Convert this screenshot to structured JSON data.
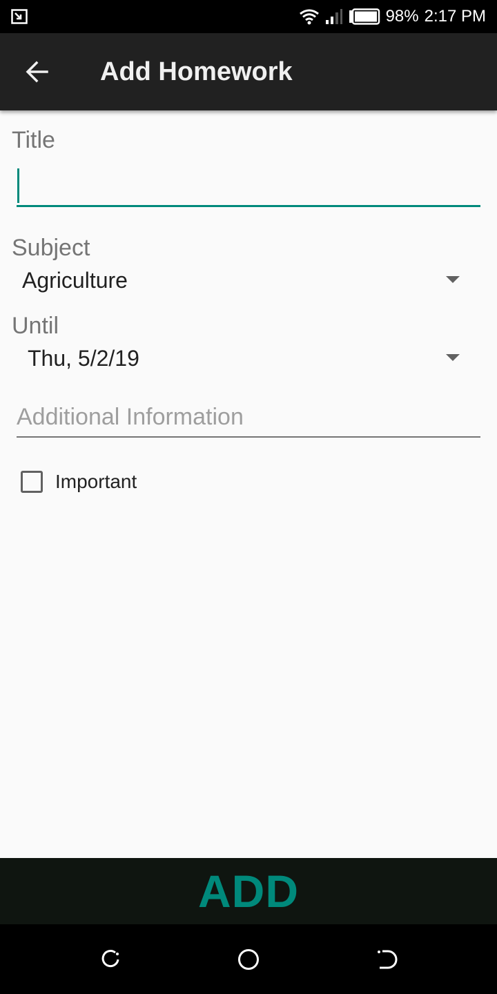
{
  "status_bar": {
    "battery": "98%",
    "time": "2:17 PM"
  },
  "app_bar": {
    "title": "Add Homework"
  },
  "form": {
    "title_label": "Title",
    "title_value": "",
    "subject_label": "Subject",
    "subject_value": "Agriculture",
    "until_label": "Until",
    "until_value": "Thu, 5/2/19",
    "info_placeholder": "Additional Information",
    "important_label": "Important",
    "important_checked": false
  },
  "actions": {
    "add_label": "ADD"
  },
  "colors": {
    "accent": "#00897b",
    "app_bar": "#212121",
    "background": "#fafafa"
  },
  "icons": [
    "screen-cast-icon",
    "wifi-icon",
    "signal-icon",
    "battery-icon",
    "back-arrow-icon",
    "dropdown-arrow-icon",
    "recents-icon",
    "home-icon",
    "back-nav-icon"
  ]
}
